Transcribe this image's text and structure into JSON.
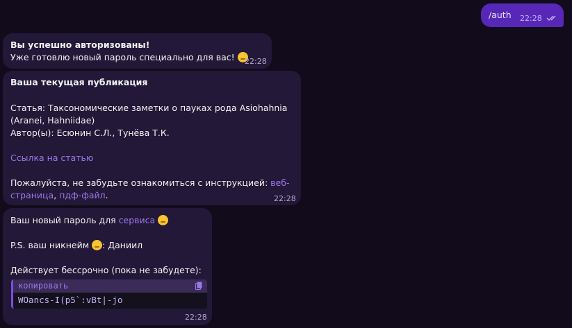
{
  "outgoing": {
    "text": "/auth",
    "time": "22:28",
    "read_icon": "double-check-icon"
  },
  "messages": [
    {
      "line1": "Вы успешно авторизованы!",
      "line2": "Уже готовлю новый пароль специально для вас!",
      "emoji": "shushing-face-emoji",
      "time": "22:28"
    },
    {
      "title": "Ваша текущая публикация",
      "article_line1": "Статья: Таксономические заметки о пауках рода Asiohahnia",
      "article_line2": "(Aranei, Hahniidae)",
      "authors": "Автор(ы): Есюнин С.Л., Тунёва Т.К.",
      "article_link": "Ссылка на статью",
      "instructions_prefix": "Пожалуйста, не забудьте ознакомиться с инструкцией:",
      "web_link_part1": "веб-",
      "web_link_part2": "страница",
      "comma": ",",
      "pdf_link": "пдф-файл",
      "period": ".",
      "time": "22:28"
    },
    {
      "password_prefix": "Ваш новый пароль для",
      "service_link": "сервиса",
      "emoji1": "woozy-face-emoji",
      "nickname_prefix": "P.S. ваш никнейм",
      "emoji2": "shushing-face-emoji",
      "nickname_value": ": Даниил",
      "validity": "Действует бессрочно (пока не забудете):",
      "code_header": "копировать",
      "copy_icon": "copy-icon",
      "password": "WOancs-I(p5`:vBt|-jo",
      "time": "22:28"
    }
  ],
  "colors": {
    "background": "#120b1c",
    "incoming_bubble": "#231838",
    "outgoing_bubble": "#5727b8",
    "link": "#9b78ea"
  }
}
